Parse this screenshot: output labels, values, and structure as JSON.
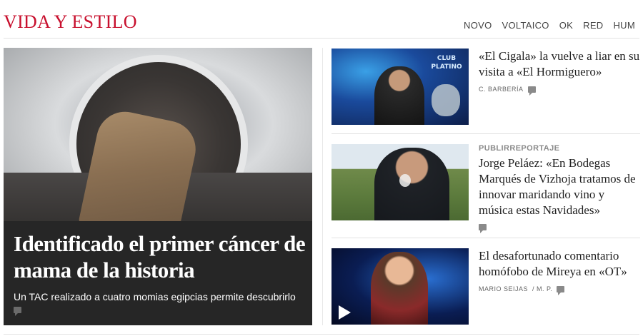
{
  "header": {
    "section_title": "VIDA Y ESTILO",
    "nav": [
      "NOVO",
      "VOLTAICO",
      "OK",
      "RED",
      "HUM"
    ]
  },
  "main_story": {
    "headline": "Identificado el primer cáncer de mama de la historia",
    "summary": "Un TAC realizado a cuatro momias egipcias permite descubrirlo",
    "icon": "comment-icon"
  },
  "side_stories": [
    {
      "headline": "«El Cigala» la vuelve a liar en su visita a «El Hormiguero»",
      "byline": "C. BARBERÍA",
      "icon": "comment-icon",
      "thumb_sign": "CLUB PLATINO"
    },
    {
      "kicker": "PUBLIRREPORTAJE",
      "headline": "Jorge Peláez: «En Bodegas Marqués de Vizhoja tratamos de innovar maridando vino y música estas Navidades»",
      "icon": "comment-icon"
    },
    {
      "headline": "El desafortunado comentario homófobo de Mireya en «OT»",
      "byline": "MARIO SEIJAS",
      "byline_extra": "/ M. P.",
      "icon": "comment-icon",
      "thumb_icon": "play-icon"
    }
  ],
  "colors": {
    "accent": "#c8102e",
    "main_story_bg": "#262626"
  }
}
